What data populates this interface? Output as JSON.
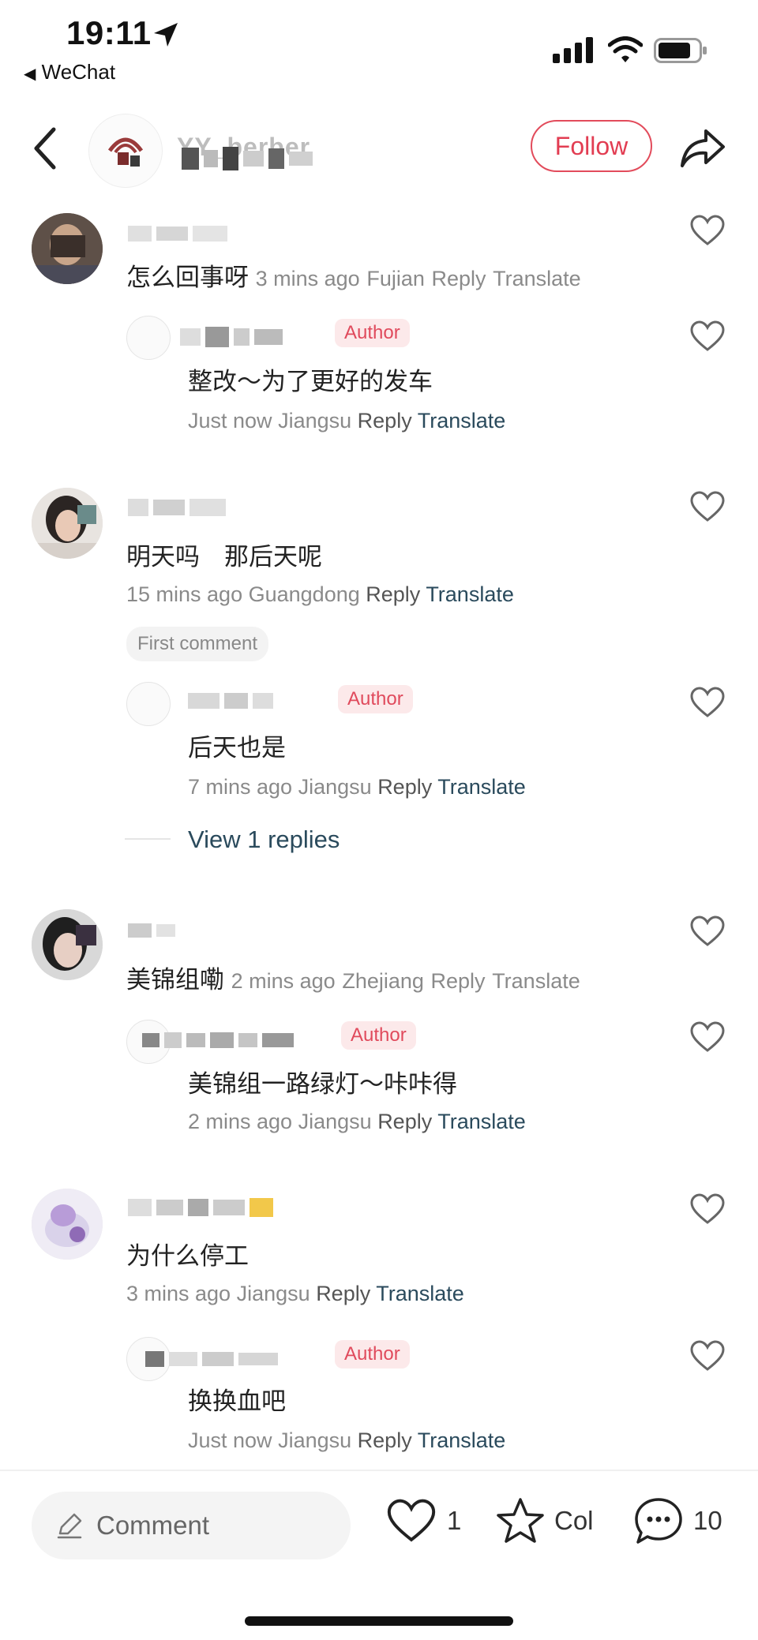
{
  "status_bar": {
    "time": "19:11",
    "back_app": "WeChat"
  },
  "header": {
    "username": "YY_berber",
    "follow_label": "Follow"
  },
  "comments": [
    {
      "text": "怎么回事呀",
      "time": "3 mins ago",
      "location": "Fujian",
      "reply": "Reply",
      "translate": "Translate"
    },
    {
      "text": "整改～为了更好的发车",
      "badge": "Author",
      "time": "Just now",
      "location": "Jiangsu",
      "reply": "Reply",
      "translate": "Translate"
    },
    {
      "text": "明天吗　那后天呢",
      "time": "15 mins ago",
      "location": "Guangdong",
      "reply": "Reply",
      "translate": "Translate",
      "tag": "First comment"
    },
    {
      "text": "后天也是",
      "badge": "Author",
      "time": "7 mins ago",
      "location": "Jiangsu",
      "reply": "Reply",
      "translate": "Translate",
      "view_replies": "View 1 replies"
    },
    {
      "text": "美锦组嘞",
      "time": "2 mins ago",
      "location": "Zhejiang",
      "reply": "Reply",
      "translate": "Translate"
    },
    {
      "text": "美锦组一路绿灯～咔咔得",
      "badge": "Author",
      "time": "2 mins ago",
      "location": "Jiangsu",
      "reply": "Reply",
      "translate": "Translate"
    },
    {
      "text": "为什么停工",
      "time": "3 mins ago",
      "location": "Jiangsu",
      "reply": "Reply",
      "translate": "Translate"
    },
    {
      "text": "换换血吧",
      "badge": "Author",
      "time": "Just now",
      "location": "Jiangsu",
      "reply": "Reply",
      "translate": "Translate"
    }
  ],
  "bottom_bar": {
    "comment_placeholder": "Comment",
    "likes": "1",
    "collect_label": "Col",
    "comments_count": "10"
  },
  "colors": {
    "accent": "#e23d52",
    "translate": "#2a4a5c",
    "badge_bg": "#fce9ea"
  }
}
